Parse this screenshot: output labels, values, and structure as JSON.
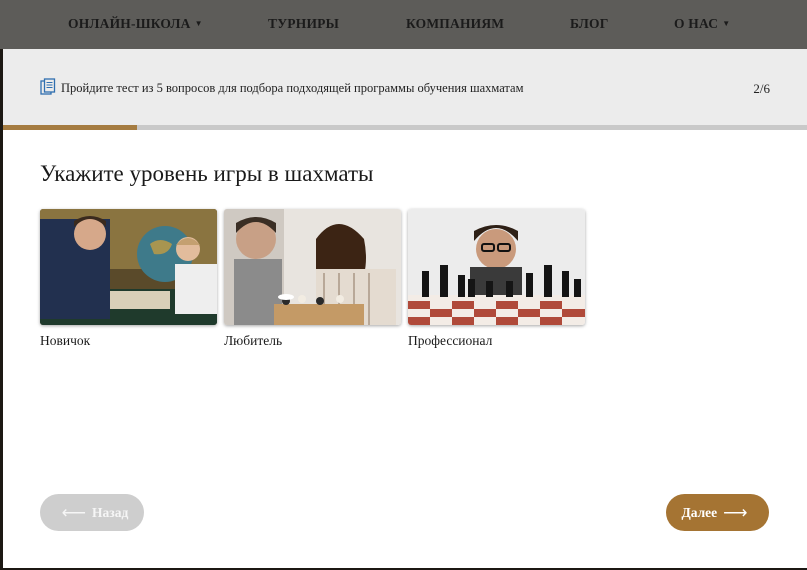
{
  "nav": {
    "items": [
      {
        "label": "ОНЛАЙН-ШКОЛА",
        "caret": "▼"
      },
      {
        "label": "ТУРНИРЫ",
        "caret": ""
      },
      {
        "label": "КОМПАНИЯМ",
        "caret": ""
      },
      {
        "label": "БЛОГ",
        "caret": ""
      },
      {
        "label": "О НАС",
        "caret": "▼"
      }
    ]
  },
  "quiz": {
    "header_text": "Пройдите тест из 5 вопросов для подбора подходящей программы обучения шахматам",
    "header_icon": "document-icon",
    "step": "2/6",
    "progress": {
      "current": 2,
      "total": 6,
      "fraction": 0.167
    },
    "question": "Укажите уровень игры в шахматы",
    "options": [
      {
        "label": "Новичок"
      },
      {
        "label": "Любитель"
      },
      {
        "label": "Профессионал"
      }
    ],
    "back_button": {
      "label": "Назад",
      "arrow": "⟵"
    },
    "next_button": {
      "label": "Далее",
      "arrow": "⟶"
    }
  },
  "colors": {
    "nav_bg": "#5d5c59",
    "header_bg": "#ececec",
    "accent": "#a57433",
    "progress_track": "#c9c9c9",
    "back_button": "#cecece"
  }
}
